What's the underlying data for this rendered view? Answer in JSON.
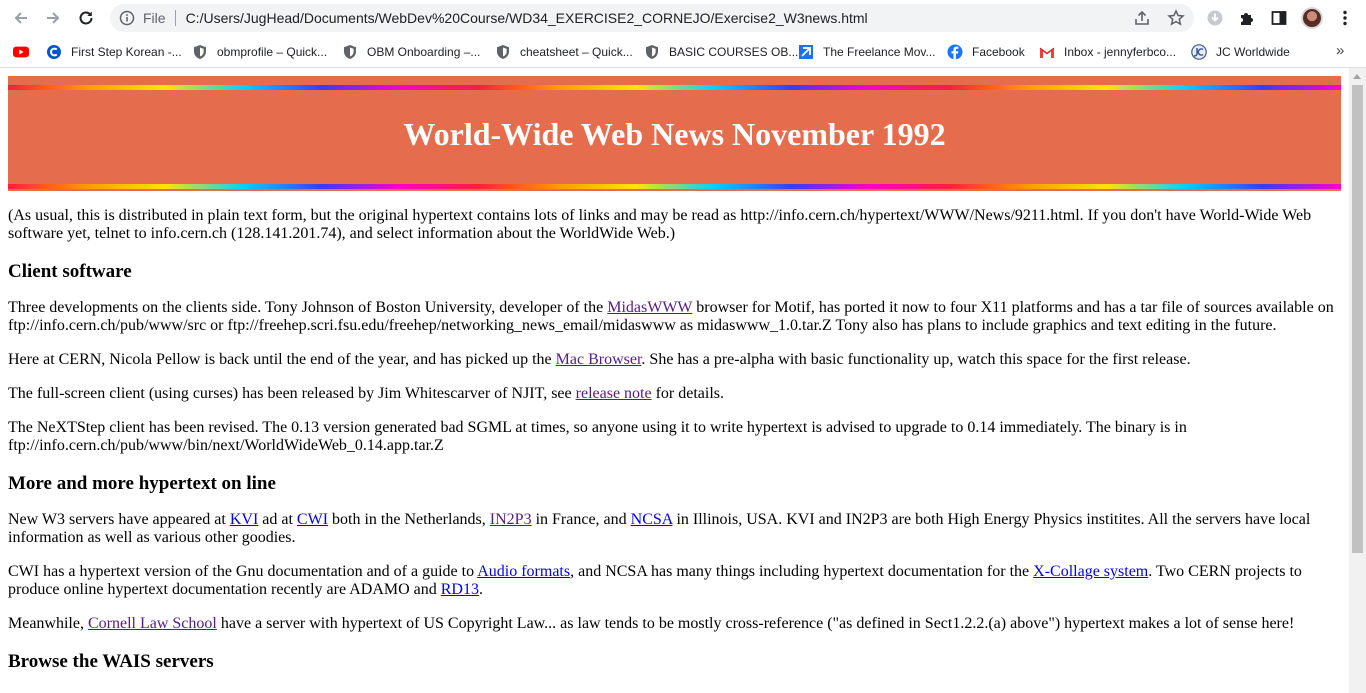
{
  "browser": {
    "url_scheme_label": "File",
    "url": "C:/Users/JugHead/Documents/WebDev%20Course/WD34_EXERCISE2_CORNEJO/Exercise2_W3news.html",
    "bookmarks": [
      {
        "label": "",
        "icon": "youtube-icon",
        "color": "#ff0000"
      },
      {
        "label": "First Step Korean -...",
        "icon": "coursera-icon",
        "color": "#0056d2"
      },
      {
        "label": "obmprofile – Quick...",
        "icon": "shield-icon",
        "color": "#5f6368"
      },
      {
        "label": "OBM Onboarding –...",
        "icon": "shield-icon",
        "color": "#5f6368"
      },
      {
        "label": "cheatsheet – Quick...",
        "icon": "shield-icon",
        "color": "#5f6368"
      },
      {
        "label": "BASIC COURSES OB...",
        "icon": "shield-icon",
        "color": "#5f6368"
      },
      {
        "label": "The Freelance Mov...",
        "icon": "freelance-icon",
        "color": "#1a73e8"
      },
      {
        "label": "Facebook",
        "icon": "facebook-icon",
        "color": "#1877f2"
      },
      {
        "label": "Inbox - jennyferbco...",
        "icon": "gmail-icon",
        "color": "#ea4335"
      },
      {
        "label": "JC Worldwide",
        "icon": "jc-logo-icon",
        "color": "#3c5a99"
      }
    ],
    "bookmarks_more": "»"
  },
  "page": {
    "banner_title": "World-Wide Web News November 1992",
    "intro": "(As usual, this is distributed in plain text form, but the original hypertext contains lots of links and may be read as http://info.cern.ch/hypertext/WWW/News/9211.html. If you don't have World-Wide Web software yet, telnet to info.cern.ch (128.141.201.74), and select information about the WorldWide Web.)",
    "s1": {
      "heading": "Client software",
      "p1_a": "Three developments on the clients side. Tony Johnson of Boston University, developer of the ",
      "p1_link": "MidasWWW",
      "p1_b": " browser for Motif, has ported it now to four X11 platforms and has a tar file of sources available on ftp://info.cern.ch/pub/www/src or ftp://freehep.scri.fsu.edu/freehep/networking_news_email/midaswww as midaswww_1.0.tar.Z Tony also has plans to include graphics and text editing in the future.",
      "p2_a": "Here at CERN, Nicola Pellow is back until the end of the year, and has picked up the ",
      "p2_link": "Mac Browser",
      "p2_b": ". She has a pre-alpha with basic functionality up, watch this space for the first release.",
      "p3_a": "The full-screen client (using curses) has been released by Jim Whitescarver of NJIT, see ",
      "p3_link": "release note",
      "p3_b": " for details.",
      "p4": "The NeXTStep client has been revised. The 0.13 version generated bad SGML at times, so anyone using it to write hypertext is advised to upgrade to 0.14 immediately. The binary is in ftp://info.cern.ch/pub/www/bin/next/WorldWideWeb_0.14.app.tar.Z"
    },
    "s2": {
      "heading": "More and more hypertext on line",
      "p1_a": "New W3 servers have appeared at ",
      "p1_kvi": "KVI",
      "p1_b": " ad at ",
      "p1_cwi": "CWI",
      "p1_c": " both in the Netherlands, ",
      "p1_in2p3": "IN2P3",
      "p1_d": " in France, and ",
      "p1_ncsa": "NCSA",
      "p1_e": " in Illinois, USA. KVI and IN2P3 are both High Energy Physics institites. All the servers have local information as well as various other goodies.",
      "p2_a": "CWI has a hypertext version of the Gnu documentation and of a guide to ",
      "p2_audio": "Audio formats",
      "p2_b": ", and NCSA has many things including hypertext documentation for the ",
      "p2_xcollage": "X-Collage system",
      "p2_c": ". Two CERN projects to produce online hypertext documentation recently are ADAMO and ",
      "p2_rd13": "RD13",
      "p2_d": ".",
      "p3_a": "Meanwhile, ",
      "p3_link": "Cornell Law School",
      "p3_b": " have a server with hypertext of US Copyright Law... as law tends to be mostly cross-reference (\"as defined in Sect1.2.2.(a) above\") hypertext makes a lot of sense here!"
    },
    "s3": {
      "heading": "Browse the WAIS servers"
    }
  },
  "colors": {
    "banner_bg": "#e56d4d",
    "link": "#0000ee",
    "visited_link": "#551a8b"
  }
}
